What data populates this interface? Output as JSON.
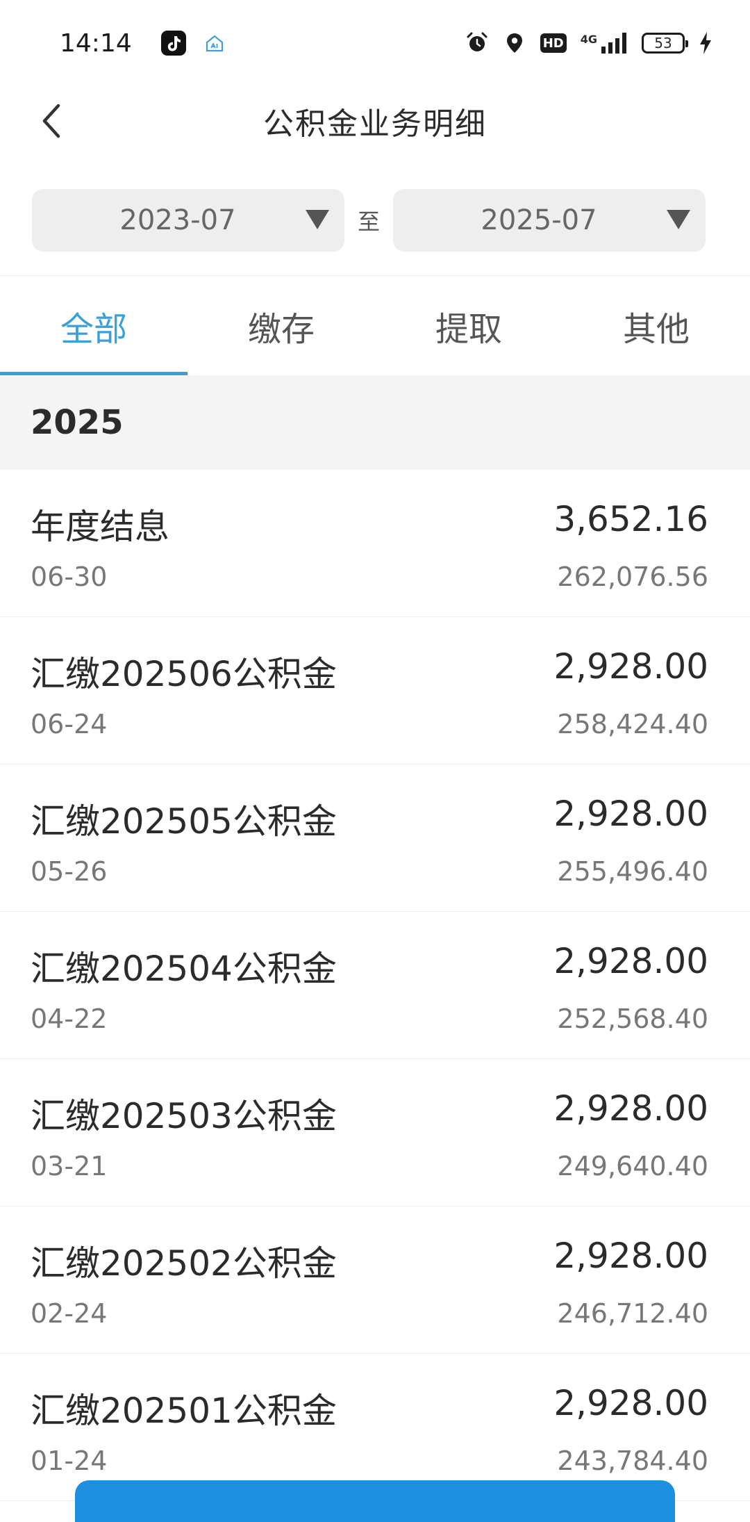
{
  "status_bar": {
    "time": "14:14",
    "network": "4G",
    "hd": "HD",
    "battery": "53",
    "icons": [
      "tiktok-icon",
      "home-app-icon",
      "alarm-icon",
      "location-icon",
      "hd-icon",
      "signal-icon",
      "battery-icon",
      "charging-icon"
    ]
  },
  "header": {
    "title": "公积金业务明细",
    "back_icon": "chevron-left-icon"
  },
  "date_range": {
    "start": "2023-07",
    "separator": "至",
    "end": "2025-07"
  },
  "tabs": [
    {
      "label": "全部",
      "active": true
    },
    {
      "label": "缴存",
      "active": false
    },
    {
      "label": "提取",
      "active": false
    },
    {
      "label": "其他",
      "active": false
    }
  ],
  "year_group": {
    "year": "2025"
  },
  "records": [
    {
      "title": "年度结息",
      "date": "06-30",
      "amount": "3,652.16",
      "balance": "262,076.56"
    },
    {
      "title": "汇缴202506公积金",
      "date": "06-24",
      "amount": "2,928.00",
      "balance": "258,424.40"
    },
    {
      "title": "汇缴202505公积金",
      "date": "05-26",
      "amount": "2,928.00",
      "balance": "255,496.40"
    },
    {
      "title": "汇缴202504公积金",
      "date": "04-22",
      "amount": "2,928.00",
      "balance": "252,568.40"
    },
    {
      "title": "汇缴202503公积金",
      "date": "03-21",
      "amount": "2,928.00",
      "balance": "249,640.40"
    },
    {
      "title": "汇缴202502公积金",
      "date": "02-24",
      "amount": "2,928.00",
      "balance": "246,712.40"
    },
    {
      "title": "汇缴202501公积金",
      "date": "01-24",
      "amount": "2,928.00",
      "balance": "243,784.40"
    }
  ],
  "colors": {
    "accent": "#3aa0d8",
    "bottom_button": "#1f8fe0"
  }
}
